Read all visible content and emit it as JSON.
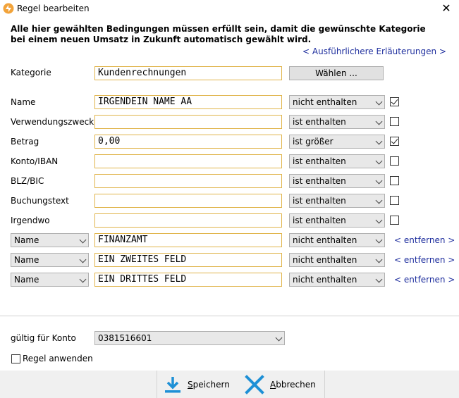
{
  "window": {
    "title": "Regel bearbeiten",
    "close": "✕"
  },
  "header": {
    "description": "Alle hier gewählten Bedingungen müssen erfüllt sein, damit die gewünschte Kategorie bei einem neuen Umsatz in Zukunft automatisch gewählt wird.",
    "help_link": "< Ausführlichere Erläuterungen >"
  },
  "kategorie": {
    "label": "Kategorie",
    "value": "Kundenrechnungen",
    "button": "Wählen ..."
  },
  "fields": [
    {
      "label": "Name",
      "value": "IRGENDEIN NAME AA",
      "op": "nicht enthalten",
      "checked": true
    },
    {
      "label": "Verwendungszweck",
      "value": "",
      "op": "ist enthalten",
      "checked": false
    },
    {
      "label": "Betrag",
      "value": "0,00",
      "op": "ist größer",
      "checked": true
    },
    {
      "label": "Konto/IBAN",
      "value": "",
      "op": "ist enthalten",
      "checked": false
    },
    {
      "label": "BLZ/BIC",
      "value": "",
      "op": "ist enthalten",
      "checked": false
    },
    {
      "label": "Buchungstext",
      "value": "",
      "op": "ist enthalten",
      "checked": false
    },
    {
      "label": "Irgendwo",
      "value": "",
      "op": "ist enthalten",
      "checked": false
    }
  ],
  "extra_rows": [
    {
      "field": "Name",
      "value": "FINANZAMT",
      "op": "nicht enthalten",
      "remove": "< entfernen >"
    },
    {
      "field": "Name",
      "value": "EIN ZWEITES FELD",
      "op": "nicht enthalten",
      "remove": "< entfernen >"
    },
    {
      "field": "Name",
      "value": "EIN DRITTES FELD",
      "op": "nicht enthalten",
      "remove": "< entfernen >"
    }
  ],
  "konto": {
    "label": "gültig für Konto",
    "value": "0381516601"
  },
  "apply": {
    "label": "Regel anwenden",
    "checked": false
  },
  "footer": {
    "save": {
      "first": "S",
      "rest": "peichern"
    },
    "cancel": {
      "first": "A",
      "rest": "bbrechen"
    }
  },
  "colors": {
    "accent_blue": "#1f2f9e",
    "field_border": "#e0b44a",
    "save_icon": "#1e90d6",
    "cancel_icon": "#1e90d6"
  }
}
